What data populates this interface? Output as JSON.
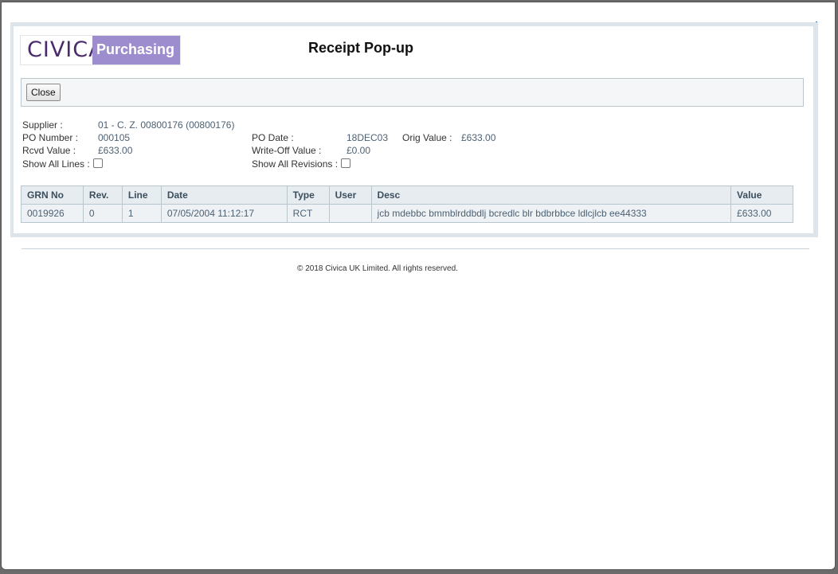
{
  "popup": {
    "logo_brand": "CIVICA",
    "logo_module": "Purchasing",
    "title": "Receipt Pop-up",
    "close_label": "Close"
  },
  "info": {
    "supplier_label": "Supplier :",
    "supplier_value": "01 - C. Z. 00800176 (00800176)",
    "po_number_label": "PO Number :",
    "po_number_value": "000105",
    "po_date_label": "PO Date :",
    "po_date_value": "18DEC03",
    "orig_value_label": "Orig Value :",
    "orig_value_value": "£633.00",
    "rcvd_value_label": "Rcvd Value :",
    "rcvd_value_value": "£633.00",
    "write_off_label": "Write-Off Value :",
    "write_off_value": "£0.00",
    "show_all_lines_label": "Show All Lines :",
    "show_all_revisions_label": "Show All Revisions :"
  },
  "table": {
    "headers": [
      "GRN No",
      "Rev.",
      "Line",
      "Date",
      "Type",
      "User",
      "Desc",
      "Value"
    ],
    "rows": [
      [
        "0019926",
        "0",
        "1",
        "07/05/2004 11:12:17",
        "RCT",
        "",
        "jcb mdebbc bmmblrddbdlj bcredlc blr bdbrbbce ldlcjlcb ee44333",
        "£633.00"
      ]
    ]
  },
  "footer": {
    "copyright": "© 2018 Civica UK Limited. All rights reserved."
  }
}
